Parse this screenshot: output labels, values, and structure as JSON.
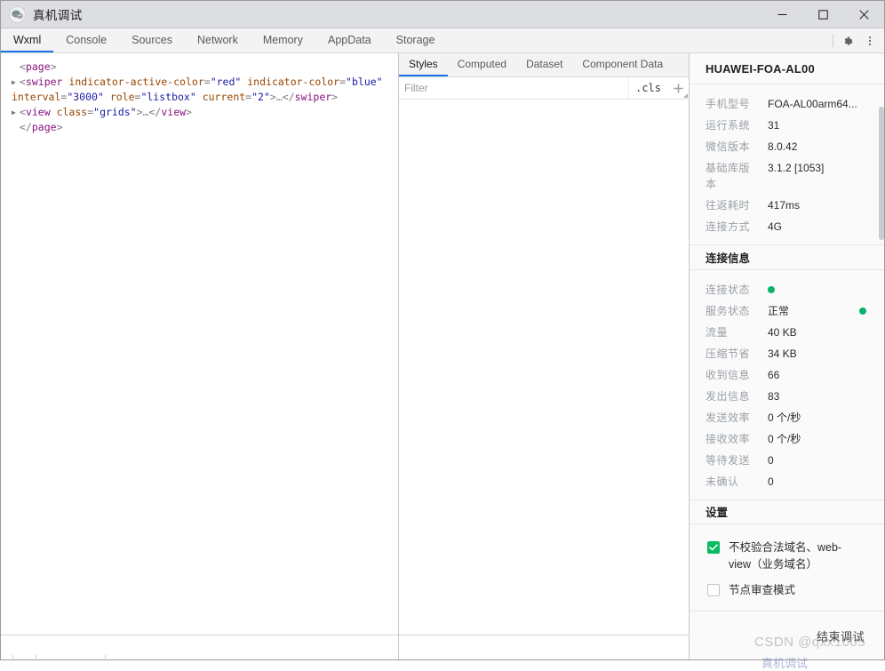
{
  "window": {
    "title": "真机调试",
    "app_icon": "wechat-bubble-icon",
    "controls": {
      "minimize": "minimize-icon",
      "maximize": "maximize-icon",
      "close": "close-icon"
    }
  },
  "devtools": {
    "tabs": [
      {
        "label": "Wxml",
        "active": true
      },
      {
        "label": "Console",
        "active": false
      },
      {
        "label": "Sources",
        "active": false
      },
      {
        "label": "Network",
        "active": false
      },
      {
        "label": "Memory",
        "active": false
      },
      {
        "label": "AppData",
        "active": false
      },
      {
        "label": "Storage",
        "active": false
      }
    ],
    "settings_icon": "gear-icon",
    "more_icon": "kebab-menu-icon"
  },
  "wxml": {
    "lines": [
      {
        "indent": 0,
        "arrow": false,
        "tokens": [
          {
            "t": "punct",
            "v": "<"
          },
          {
            "t": "tag",
            "v": "page"
          },
          {
            "t": "punct",
            "v": ">"
          }
        ]
      },
      {
        "indent": 1,
        "arrow": true,
        "tokens": [
          {
            "t": "punct",
            "v": "<"
          },
          {
            "t": "tag",
            "v": "swiper"
          },
          {
            "t": "plain",
            "v": " "
          },
          {
            "t": "attr",
            "v": "indicator-active-color"
          },
          {
            "t": "punct",
            "v": "="
          },
          {
            "t": "val",
            "v": "\"red\""
          },
          {
            "t": "plain",
            "v": " "
          },
          {
            "t": "attr",
            "v": "indicator-color"
          },
          {
            "t": "punct",
            "v": "="
          },
          {
            "t": "val",
            "v": "\"blue\""
          },
          {
            "t": "plain",
            "v": " "
          },
          {
            "t": "attr",
            "v": "interval"
          },
          {
            "t": "punct",
            "v": "="
          },
          {
            "t": "val",
            "v": "\"3000\""
          },
          {
            "t": "plain",
            "v": " "
          },
          {
            "t": "attr",
            "v": "role"
          },
          {
            "t": "punct",
            "v": "="
          },
          {
            "t": "val",
            "v": "\"listbox\""
          },
          {
            "t": "plain",
            "v": " "
          },
          {
            "t": "attr",
            "v": "current"
          },
          {
            "t": "punct",
            "v": "="
          },
          {
            "t": "val",
            "v": "\"2\""
          },
          {
            "t": "punct",
            "v": ">"
          },
          {
            "t": "ellip",
            "v": "…"
          },
          {
            "t": "punct",
            "v": "</"
          },
          {
            "t": "tag",
            "v": "swiper"
          },
          {
            "t": "punct",
            "v": ">"
          }
        ]
      },
      {
        "indent": 1,
        "arrow": true,
        "tokens": [
          {
            "t": "punct",
            "v": "<"
          },
          {
            "t": "tag",
            "v": "view"
          },
          {
            "t": "plain",
            "v": " "
          },
          {
            "t": "attr",
            "v": "class"
          },
          {
            "t": "punct",
            "v": "="
          },
          {
            "t": "val",
            "v": "\"grids\""
          },
          {
            "t": "punct",
            "v": ">"
          },
          {
            "t": "ellip",
            "v": "…"
          },
          {
            "t": "punct",
            "v": "</"
          },
          {
            "t": "tag",
            "v": "view"
          },
          {
            "t": "punct",
            "v": ">"
          }
        ]
      },
      {
        "indent": 0,
        "arrow": false,
        "tokens": [
          {
            "t": "punct",
            "v": "</"
          },
          {
            "t": "tag",
            "v": "page"
          },
          {
            "t": "punct",
            "v": ">"
          }
        ]
      }
    ]
  },
  "styles_panel": {
    "tabs": [
      {
        "label": "Styles",
        "active": true
      },
      {
        "label": "Computed",
        "active": false
      },
      {
        "label": "Dataset",
        "active": false
      },
      {
        "label": "Component Data",
        "active": false
      }
    ],
    "filter": {
      "value": "",
      "placeholder": "Filter"
    },
    "cls_label": ".cls",
    "add_icon": "plus-icon"
  },
  "device": {
    "name": "HUAWEI-FOA-AL00",
    "info": [
      {
        "label": "手机型号",
        "value": "FOA-AL00arm64..."
      },
      {
        "label": "运行系统",
        "value": "31"
      },
      {
        "label": "微信版本",
        "value": "8.0.42"
      },
      {
        "label": "基础库版本",
        "value": "3.1.2 [1053]"
      },
      {
        "label": "往返耗时",
        "value": "417ms"
      },
      {
        "label": "连接方式",
        "value": "4G"
      }
    ],
    "connection_section_title": "连接信息",
    "connection": [
      {
        "label": "连接状态",
        "value": "",
        "dot": true,
        "dot_right": false
      },
      {
        "label": "服务状态",
        "value": "正常",
        "dot": false,
        "dot_right": true
      },
      {
        "label": "流量",
        "value": "40 KB",
        "dot": false,
        "dot_right": false
      },
      {
        "label": "压缩节省",
        "value": "34 KB",
        "dot": false,
        "dot_right": false
      },
      {
        "label": "收到信息",
        "value": "66",
        "dot": false,
        "dot_right": false
      },
      {
        "label": "发出信息",
        "value": "83",
        "dot": false,
        "dot_right": false
      },
      {
        "label": "发送效率",
        "value": "0 个/秒",
        "dot": false,
        "dot_right": false
      },
      {
        "label": "接收效率",
        "value": "0 个/秒",
        "dot": false,
        "dot_right": false
      },
      {
        "label": "等待发送",
        "value": "0",
        "dot": false,
        "dot_right": false
      },
      {
        "label": "未确认",
        "value": "0",
        "dot": false,
        "dot_right": false
      }
    ],
    "settings_section_title": "设置",
    "settings": [
      {
        "label": "不校验合法域名、web-view（业务域名）",
        "checked": true
      },
      {
        "label": "节点审查模式",
        "checked": false
      }
    ],
    "end_debug_button": "结束调试"
  },
  "watermark": {
    "text": "CSDN @qxx1005",
    "overlay_text": "真机调试"
  },
  "colors": {
    "accent": "#1a73e8",
    "status_green": "#09b36b",
    "checkbox_green": "#09bb5f",
    "titlebar": "#dcdee2",
    "tag": "#881280",
    "attr": "#994500",
    "value": "#1a1aa6"
  }
}
